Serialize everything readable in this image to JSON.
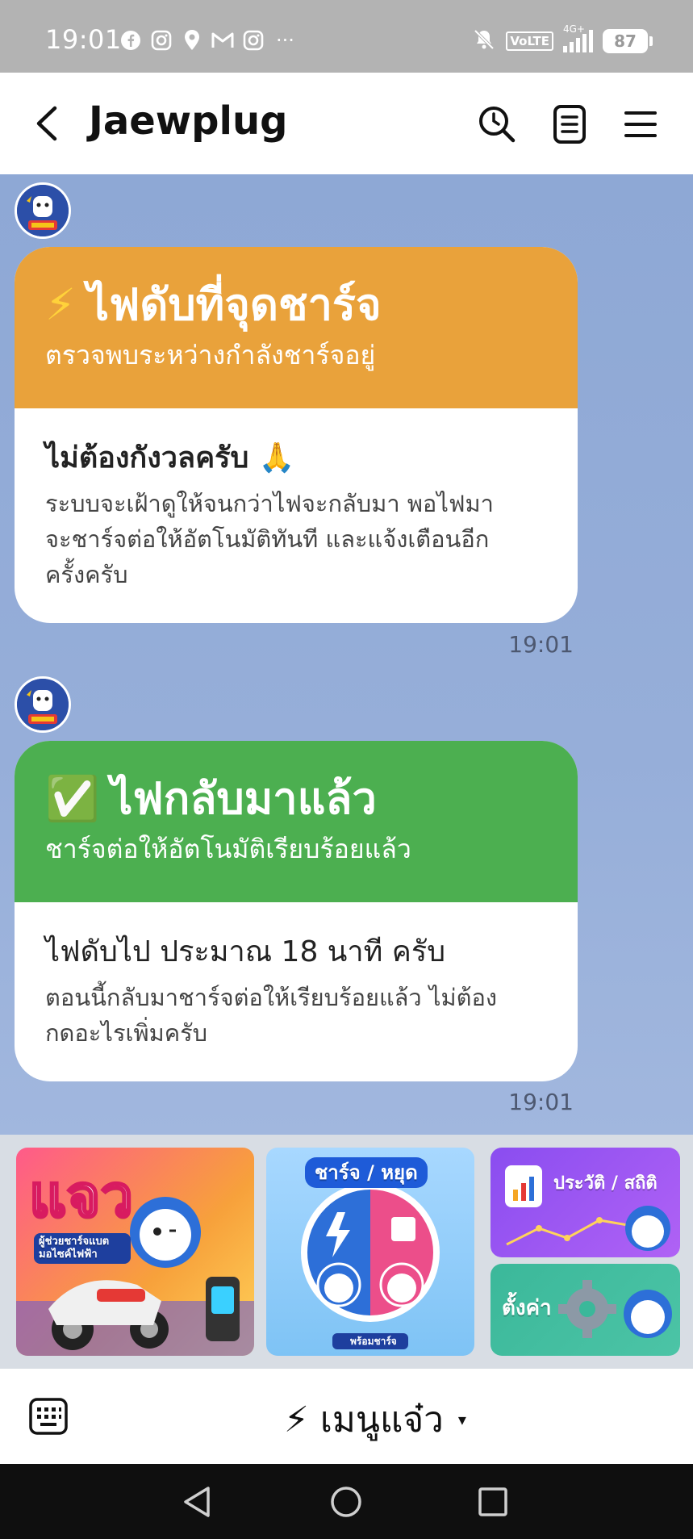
{
  "status_bar": {
    "time": "19:01",
    "notification_icons": [
      "facebook-icon",
      "instagram-icon",
      "location-icon",
      "gmail-icon",
      "instagram-icon"
    ],
    "more": "···",
    "volte": "VoLTE",
    "network": "4G+",
    "battery": "87"
  },
  "header": {
    "title": "Jaewplug",
    "icons": [
      "back-icon",
      "search-icon",
      "notes-icon",
      "menu-icon"
    ]
  },
  "messages": [
    {
      "head_emoji": "⚡",
      "title": "ไฟดับที่จุดชาร์จ",
      "subtitle": "ตรวจพบระหว่างกำลังชาร์จอยู่",
      "head_color": "#e9a23b",
      "body_title": "ไม่ต้องกังวลครับ 🙏",
      "body_lines": [
        "ระบบจะเฝ้าดูให้จนกว่าไฟจะกลับมา พอไฟมา",
        "จะชาร์จต่อให้อัตโนมัติทันที และแจ้งเตือนอีก",
        "ครั้งครับ"
      ],
      "time": "19:01"
    },
    {
      "head_emoji": "✅",
      "title": "ไฟกลับมาแล้ว",
      "subtitle": "ชาร์จต่อให้อัตโนมัติเรียบร้อยแล้ว",
      "head_color": "#4caf50",
      "body_title": "ไฟดับไป ประมาณ 18 นาที ครับ",
      "body_lines": [
        "ตอนนี้กลับมาชาร์จต่อให้เรียบร้อยแล้ว ไม่ต้อง",
        "กดอะไรเพิ่มครับ"
      ],
      "time": "19:01"
    }
  ],
  "rich_menu": {
    "tile1_title": "แจว",
    "tile1_sub": "ผู้ช่วยชาร์จแบต มอไซค์ไฟฟ้า",
    "tile2_title": "ชาร์จ / หยุด",
    "tile2_badge": "พร้อมชาร์จ",
    "tile3_title": "ประวัติ / สถิติ",
    "tile4_title": "ตั้งค่า"
  },
  "bottom_bar": {
    "menu_label": "⚡ เมนูแจ๋ว",
    "caret": "▾"
  },
  "colors": {
    "chat_bg": "#8fa9d6",
    "orange": "#e9a23b",
    "green": "#4caf50"
  }
}
